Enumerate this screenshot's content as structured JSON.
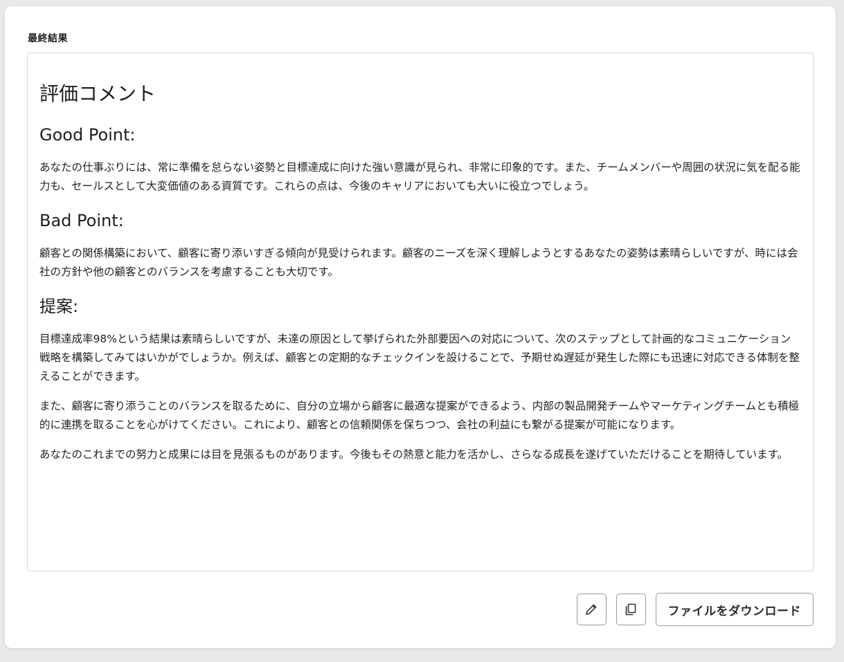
{
  "section_label": "最終結果",
  "result": {
    "heading": "評価コメント",
    "good_point": {
      "heading": "Good Point:",
      "paragraphs": [
        "あなたの仕事ぶりには、常に準備を怠らない姿勢と目標達成に向けた強い意識が見られ、非常に印象的です。また、チームメンバーや周囲の状況に気を配る能力も、セールスとして大変価値のある資質です。これらの点は、今後のキャリアにおいても大いに役立つでしょう。"
      ]
    },
    "bad_point": {
      "heading": "Bad Point:",
      "paragraphs": [
        "顧客との関係構築において、顧客に寄り添いすぎる傾向が見受けられます。顧客のニーズを深く理解しようとするあなたの姿勢は素晴らしいですが、時には会社の方針や他の顧客とのバランスを考慮することも大切です。"
      ]
    },
    "proposal": {
      "heading": "提案:",
      "paragraphs": [
        "目標達成率98%という結果は素晴らしいですが、未達の原因として挙げられた外部要因への対応について、次のステップとして計画的なコミュニケーション戦略を構築してみてはいかがでしょうか。例えば、顧客との定期的なチェックインを設けることで、予期せぬ遅延が発生した際にも迅速に対応できる体制を整えることができます。",
        "また、顧客に寄り添うことのバランスを取るために、自分の立場から顧客に最適な提案ができるよう、内部の製品開発チームやマーケティングチームとも積極的に連携を取ることを心がけてください。これにより、顧客との信頼関係を保ちつつ、会社の利益にも繋がる提案が可能になります。",
        "あなたのこれまでの努力と成果には目を見張るものがあります。今後もその熱意と能力を活かし、さらなる成長を遂げていただけることを期待しています。"
      ]
    }
  },
  "actions": {
    "edit_icon": "pencil-icon",
    "copy_icon": "copy-icon",
    "download_label": "ファイルをダウンロード"
  }
}
